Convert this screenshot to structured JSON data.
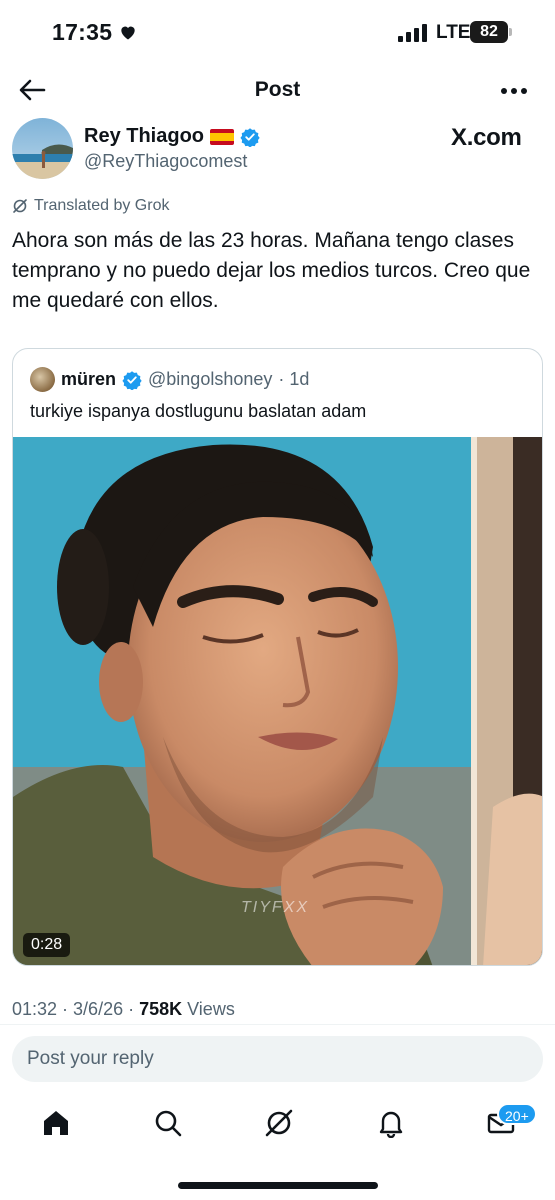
{
  "status_bar": {
    "time": "17:35",
    "network": "LTE",
    "battery": "82"
  },
  "header": {
    "title": "Post"
  },
  "author": {
    "name": "Rey Thiagoo",
    "handle": "@ReyThiagocomest",
    "watermark": "X.com"
  },
  "translation_label": "Translated by Grok",
  "post_text": "Ahora son más de las 23 horas. Mañana tengo clases temprano y no puedo dejar los medios turcos. Creo que me quedaré con ellos.",
  "quote": {
    "name": "müren",
    "handle": "@bingolshoney",
    "time": "· 1d",
    "text": "turkiye ispanya dostlugunu baslatan adam",
    "video_duration": "0:28",
    "video_watermark": "TIYFXX"
  },
  "meta": {
    "time_date": "01:32 · 3/6/26 · ",
    "views_count": "758K",
    "views_label": " Views"
  },
  "reply": {
    "placeholder": "Post your reply"
  },
  "nav": {
    "messages_badge": "20+"
  },
  "colors": {
    "accent": "#1d9bf0",
    "text": "#0f1419",
    "muted": "#536471"
  },
  "icons": [
    "heart-icon",
    "signal-icon",
    "back-arrow-icon",
    "more-icon",
    "verified-icon",
    "grok-icon",
    "home-icon",
    "search-icon",
    "grok-nav-icon",
    "notifications-icon",
    "messages-icon"
  ]
}
